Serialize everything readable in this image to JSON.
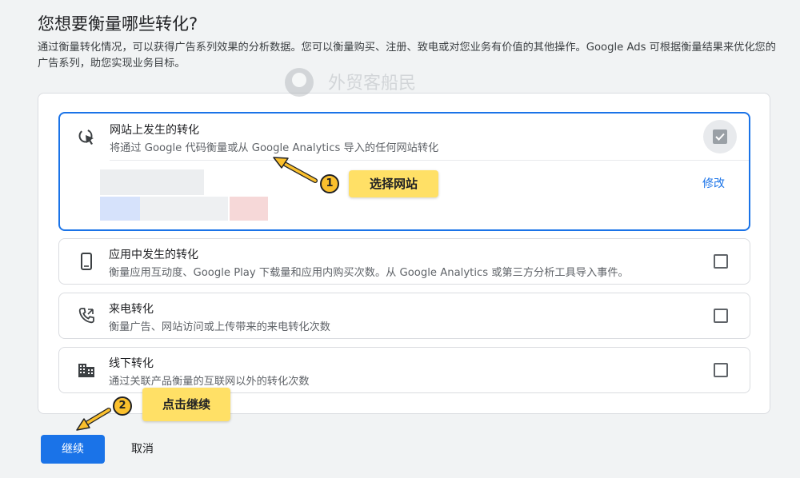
{
  "header": {
    "title": "您想要衡量哪些转化?",
    "intro": "通过衡量转化情况，可以获得广告系列效果的分析数据。您可以衡量购买、注册、致电或对您业务有价值的其他操作。Google Ads 可根据衡量结果来优化您的广告系列，助您实现业务目标。"
  },
  "watermark": {
    "text": "外贸客船民"
  },
  "options": [
    {
      "title": "网站上发生的转化",
      "desc": "将通过 Google 代码衡量或从 Google Analytics 导入的任何网站转化",
      "icon": "cursor-click-icon",
      "checked": true,
      "edit_label": "修改"
    },
    {
      "title": "应用中发生的转化",
      "desc": "衡量应用互动度、Google Play 下载量和应用内购买次数。从 Google Analytics 或第三方分析工具导入事件。",
      "icon": "smartphone-icon",
      "checked": false
    },
    {
      "title": "来电转化",
      "desc": "衡量广告、网站访问或上传带来的来电转化次数",
      "icon": "phone-call-icon",
      "checked": false
    },
    {
      "title": "线下转化",
      "desc": "通过关联产品衡量的互联网以外的转化次数",
      "icon": "building-icon",
      "checked": false
    }
  ],
  "annotations": [
    {
      "number": "1",
      "label": "选择网站"
    },
    {
      "number": "2",
      "label": "点击继续"
    }
  ],
  "footer": {
    "continue_label": "继续",
    "cancel_label": "取消"
  },
  "colors": {
    "accent": "#1a73e8",
    "callout": "#ffe066",
    "badge": "#fbc02d"
  }
}
